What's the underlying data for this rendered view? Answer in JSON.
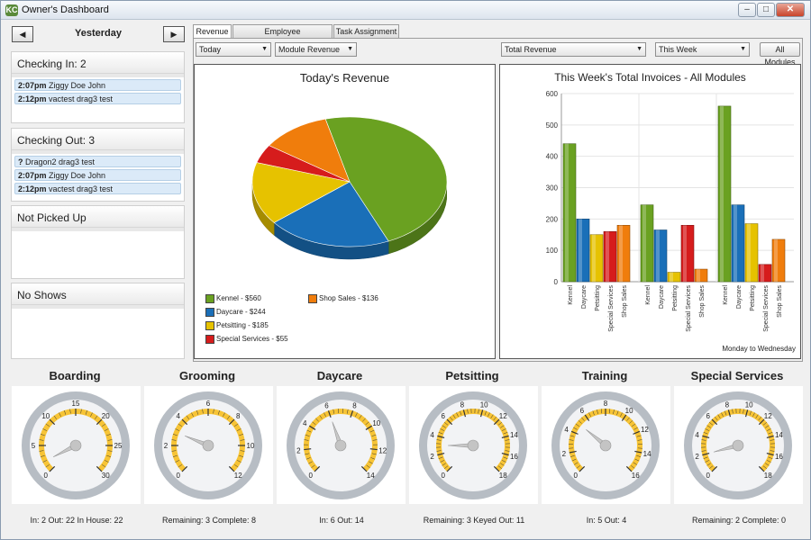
{
  "window": {
    "title": "Owner's Dashboard",
    "icon_text": "KC",
    "minimize": "–",
    "maximize": "□",
    "close": "✕"
  },
  "left": {
    "prev": "◀",
    "next": "▶",
    "day": "Yesterday",
    "checking_in": {
      "title": "Checking In: 2",
      "rows": [
        {
          "time": "2:07pm",
          "name": "Ziggy Doe John"
        },
        {
          "time": "2:12pm",
          "name": "vactest drag3 test"
        }
      ]
    },
    "checking_out": {
      "title": "Checking Out: 3",
      "rows": [
        {
          "time": "?",
          "name": "Dragon2 drag3 test"
        },
        {
          "time": "2:07pm",
          "name": "Ziggy Doe John"
        },
        {
          "time": "2:12pm",
          "name": "vactest drag3 test"
        }
      ]
    },
    "not_picked_up": {
      "title": "Not Picked Up"
    },
    "no_shows": {
      "title": "No Shows"
    }
  },
  "tabs": [
    "Revenue",
    "Employee Communications",
    "Task Assignment"
  ],
  "controls": {
    "period": "Today",
    "revenue_type": "Module Revenue",
    "invoice_type": "Total Revenue",
    "week": "This Week",
    "all_modules": "All Modules"
  },
  "icons": {
    "dropdown": "▼"
  },
  "colors": {
    "Kennel": "#6aa121",
    "Daycare": "#1a6fb8",
    "Petsitting": "#e6c200",
    "Special Services": "#d61c1c",
    "Shop Sales": "#f07d0c"
  },
  "chart_data": [
    {
      "type": "pie",
      "title": "Today's Revenue",
      "slices": [
        {
          "label": "Kennel",
          "value": 560,
          "legend": "Kennel - $560"
        },
        {
          "label": "Daycare",
          "value": 244,
          "legend": "Daycare - $244"
        },
        {
          "label": "Petsitting",
          "value": 185,
          "legend": "Petsitting - $185"
        },
        {
          "label": "Special Services",
          "value": 55,
          "legend": "Special Services - $55"
        },
        {
          "label": "Shop Sales",
          "value": 136,
          "legend": "Shop Sales - $136"
        }
      ]
    },
    {
      "type": "bar",
      "title": "This Week's Total Invoices - All Modules",
      "categories": [
        "Kennel",
        "Daycare",
        "Petsitting",
        "Special Services",
        "Shop Sales"
      ],
      "series": [
        {
          "values": [
            440,
            200,
            150,
            160,
            180
          ]
        },
        {
          "values": [
            245,
            165,
            30,
            180,
            40
          ]
        },
        {
          "values": [
            560,
            245,
            185,
            55,
            135
          ]
        }
      ],
      "ylim": [
        0,
        600
      ],
      "yticks": [
        "0",
        "100",
        "200",
        "300",
        "400",
        "500",
        "600"
      ],
      "note": "Monday to Wednesday",
      "grid": true
    }
  ],
  "gauges": [
    {
      "title": "Boarding",
      "max": 30,
      "ticks": [
        "0",
        "5",
        "10",
        "15",
        "20",
        "25",
        "30"
      ],
      "value": 2,
      "stats": "In: 2  Out: 22  In House: 22"
    },
    {
      "title": "Grooming",
      "max": 12,
      "ticks": [
        "0",
        "2",
        "4",
        "6",
        "8",
        "10",
        "12"
      ],
      "value": 3,
      "stats": "Remaining: 3  Complete: 8"
    },
    {
      "title": "Daycare",
      "max": 14,
      "ticks": [
        "0",
        "2",
        "4",
        "6",
        "8",
        "10",
        "12",
        "14"
      ],
      "value": 6,
      "stats": "In: 6  Out: 14"
    },
    {
      "title": "Petsitting",
      "max": 18,
      "ticks": [
        "0",
        "2",
        "4",
        "6",
        "8",
        "10",
        "12",
        "14",
        "16",
        "18"
      ],
      "value": 3,
      "stats": "Remaining: 3  Keyed Out: 11"
    },
    {
      "title": "Training",
      "max": 16,
      "ticks": [
        "0",
        "2",
        "4",
        "6",
        "8",
        "10",
        "12",
        "14",
        "16"
      ],
      "value": 5,
      "stats": "In: 5  Out: 4"
    },
    {
      "title": "Special Services",
      "max": 18,
      "ticks": [
        "0",
        "2",
        "4",
        "6",
        "8",
        "10",
        "12",
        "14",
        "16",
        "18"
      ],
      "value": 2,
      "stats": "Remaining: 2  Complete: 0"
    }
  ]
}
